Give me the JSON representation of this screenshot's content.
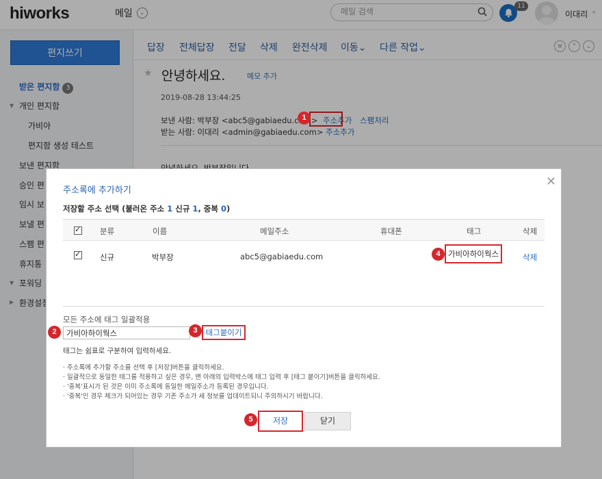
{
  "topbar": {
    "logo_text": "hiworks",
    "app_name": "메일",
    "search_placeholder": "메일 검색",
    "notification_count": "11",
    "user_name": "이대리"
  },
  "sidebar": {
    "compose_label": "편지쓰기",
    "inbox_label": "받은 편지함",
    "inbox_count": "3",
    "personal_folder_label": "개인 편지함",
    "personal_items": [
      "가비아",
      "편지함 생성 테스트"
    ],
    "items": [
      "보낸 편지함",
      "승인 편",
      "임시 보",
      "보낼 편",
      "스팸 편",
      "휴지통"
    ],
    "forwarding_label": "포워딩",
    "settings_label": "환경설정"
  },
  "toolbar": {
    "reply": "답장",
    "reply_all": "전체답장",
    "forward": "전달",
    "delete": "삭제",
    "perm_delete": "완전삭제",
    "move": "이동",
    "other_actions": "다른 작업"
  },
  "message": {
    "subject": "안녕하세요.",
    "memo_label": "메모 추가",
    "date": "2019-08-28 13:44:25",
    "from_label": "보낸 사람:",
    "from_value": "박부장 <abc5@gabiaedu.com>",
    "add_contact_label": "주소추가",
    "spam_label": "스팸처리",
    "to_label": "받는 사람:",
    "to_value": "이대리 <admin@gabiaedu.com>",
    "body_preview": "안녕하세요. 박부장입니다."
  },
  "modal": {
    "title": "주소록에 추가하기",
    "summary_prefix": "저장할 주소 선택 (불러온 주소 ",
    "loaded_count": "1",
    "summary_new": " 신규 ",
    "new_count": "1",
    "summary_dup": ", 중복 ",
    "dup_count": "0",
    "summary_suffix": ")",
    "columns": {
      "type": "분류",
      "name": "이름",
      "email": "메일주소",
      "phone": "휴대폰",
      "tag": "태그",
      "delete": "삭제"
    },
    "row": {
      "type": "신규",
      "name": "박부장",
      "email": "abc5@gabiaedu.com",
      "phone": "",
      "tag": "가비아하이웍스",
      "delete": "삭제"
    },
    "bulk_tag_label": "모든 주소에 태그 일괄적용",
    "bulk_tag_value": "가비아하이웍스",
    "tag_apply_label": "태그붙이기",
    "tag_help": "태그는 쉼표로 구분하여 입력하세요.",
    "notes": [
      "· 주소록에 추가할 주소를 선택 후 [저장]버튼을 클릭하세요.",
      "· 일괄적으로 동일한 태그를 적용하고 싶은 경우, 맨 아래의 입력박스에 태그 입력 후 [태그 붙이기]버튼을 클릭하세요.",
      "· '중복'표시가 된 것은 이미 주소록에 동일한 메일주소가 등록된 경우입니다.",
      "· '중복'인 경우 체크가 되어있는 경우 기존 주소가 새 정보를 업데이트되니 주의하시기 바랍니다."
    ],
    "save_label": "저장",
    "close_label": "닫기"
  },
  "steps": [
    "1",
    "2",
    "3",
    "4",
    "5"
  ],
  "colors": {
    "accent": "#2f7bd7",
    "link": "#2e6dbd",
    "highlight": "#d6262b"
  }
}
